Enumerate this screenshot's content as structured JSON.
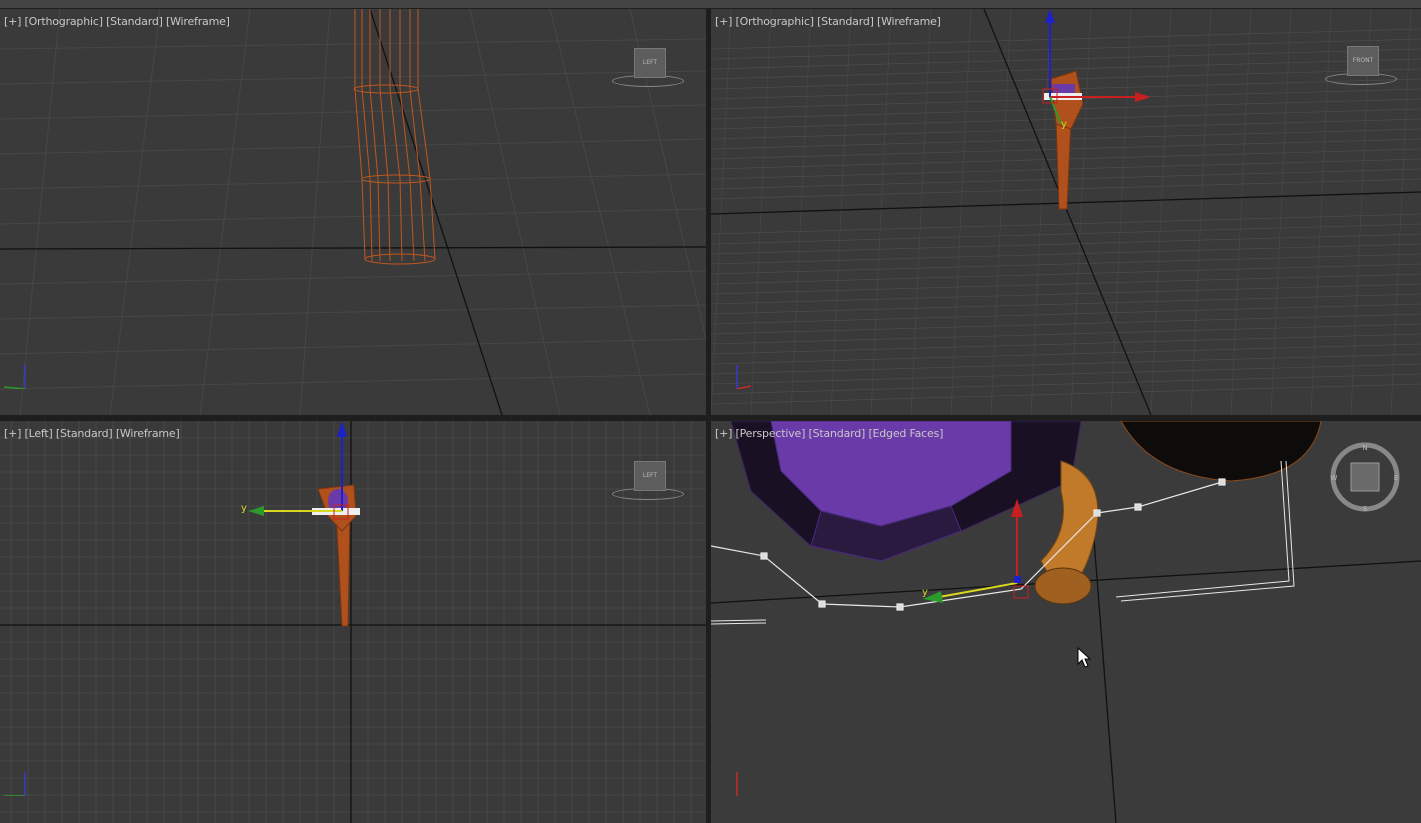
{
  "viewports": {
    "top_left": {
      "label_plus": "[+]",
      "label_view": "[Orthographic]",
      "label_shading1": "[Standard]",
      "label_shading2": "[Wireframe]",
      "viewcube": "LEFT"
    },
    "top_right": {
      "label_plus": "[+]",
      "label_view": "[Orthographic]",
      "label_shading1": "[Standard]",
      "label_shading2": "[Wireframe]",
      "viewcube": "FRONT"
    },
    "bottom_left": {
      "label_plus": "[+]",
      "label_view": "[Left]",
      "label_shading1": "[Standard]",
      "label_shading2": "[Wireframe]",
      "viewcube": "LEFT",
      "gizmo_axis": "y"
    },
    "bottom_right": {
      "label_plus": "[+]",
      "label_view": "[Perspective]",
      "label_shading1": "[Standard]",
      "label_shading2": "[Edged Faces]",
      "gizmo_axis": "y",
      "compass": [
        "N",
        "S",
        "W",
        "E"
      ]
    }
  },
  "axis_labels": {
    "z": "z",
    "y": "y",
    "x": "x"
  },
  "colors": {
    "viewport_bg": "#3a3a3a",
    "grid": "#4c4c4c",
    "wire_orange": "#c0571d",
    "purple": "#6a3aa8",
    "active_border": "#9a8346"
  }
}
